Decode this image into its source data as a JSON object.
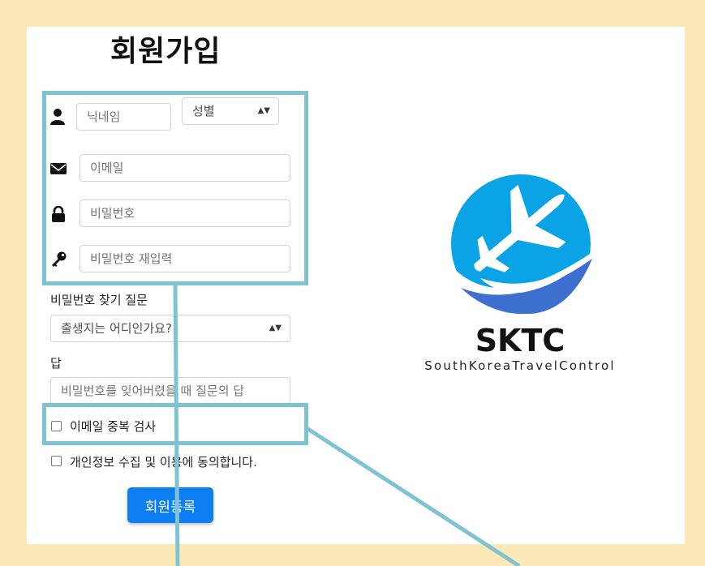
{
  "page": {
    "title": "회원가입",
    "colors": {
      "background": "#fde9b7",
      "accent": "#0d7ff2",
      "highlight": "#7fc3d3",
      "logo_blue": "#0aa3e6"
    }
  },
  "form": {
    "nickname": {
      "placeholder": "닉네임",
      "icon": "user-icon"
    },
    "gender": {
      "selected": "성별"
    },
    "email": {
      "placeholder": "이메일",
      "icon": "envelope-icon"
    },
    "password": {
      "placeholder": "비밀번호",
      "icon": "lock-icon"
    },
    "password_confirm": {
      "placeholder": "비밀번호 재입력",
      "icon": "key-icon"
    },
    "question": {
      "label": "비밀번호 찾기 질문",
      "selected": "출생지는 어디인가요?"
    },
    "answer": {
      "label": "답",
      "placeholder": "비밀번호를 잊어버렸을 때 질문의 답"
    },
    "email_check_label": "이메일 중복 검사",
    "agree_label": "개인정보 수집 및 이용에 동의합니다.",
    "submit_label": "회원등록"
  },
  "logo": {
    "name": "SKTC",
    "subtitle": "SouthKoreaTravelControl"
  }
}
